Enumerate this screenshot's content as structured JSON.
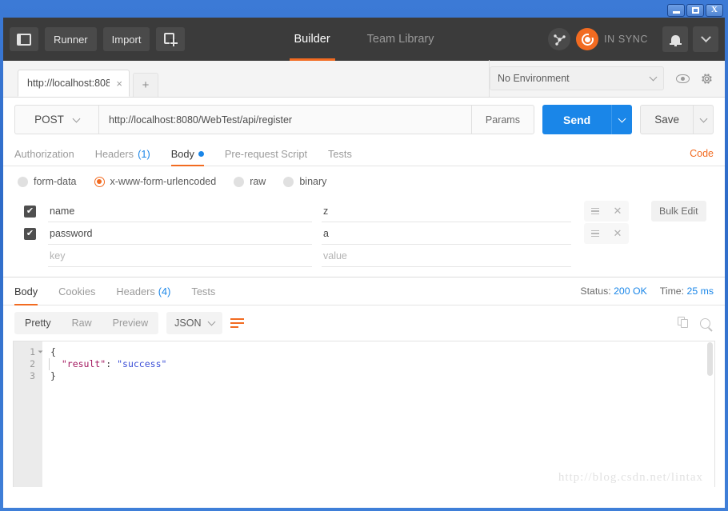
{
  "window": {
    "controls": {
      "minimize": "–",
      "maximize": "□",
      "close": "X"
    }
  },
  "header": {
    "sidebar_toggle": "sidebar-toggle",
    "runner_label": "Runner",
    "import_label": "Import",
    "new_label": "new-request",
    "nav_tabs": [
      {
        "label": "Builder",
        "active": true
      },
      {
        "label": "Team Library",
        "active": false
      }
    ],
    "sync_status": "IN SYNC",
    "accent_orange": "#f26b21",
    "accent_blue": "#1a86e8"
  },
  "tabstrip": {
    "request_tab_label": "http://localhost:808",
    "close_glyph": "×",
    "new_tab_glyph": "+",
    "environment_selected": "No Environment",
    "eye_icon": "eye-icon",
    "gear_icon": "gear-icon"
  },
  "request": {
    "method": "POST",
    "url": "http://localhost:8080/WebTest/api/register",
    "params_label": "Params",
    "send_label": "Send",
    "save_label": "Save",
    "tabs": [
      {
        "label": "Authorization",
        "count": "",
        "active": false,
        "dot": false
      },
      {
        "label": "Headers",
        "count": "(1)",
        "active": false,
        "dot": false
      },
      {
        "label": "Body",
        "count": "",
        "active": true,
        "dot": true
      },
      {
        "label": "Pre-request Script",
        "count": "",
        "active": false,
        "dot": false
      },
      {
        "label": "Tests",
        "count": "",
        "active": false,
        "dot": false
      }
    ],
    "code_link": "Code",
    "body_types": [
      {
        "label": "form-data",
        "selected": false
      },
      {
        "label": "x-www-form-urlencoded",
        "selected": true
      },
      {
        "label": "raw",
        "selected": false
      },
      {
        "label": "binary",
        "selected": false
      }
    ],
    "bulk_edit_label": "Bulk Edit",
    "key_placeholder": "key",
    "value_placeholder": "value",
    "params": [
      {
        "enabled": true,
        "key": "name",
        "value": "z"
      },
      {
        "enabled": true,
        "key": "password",
        "value": "a"
      }
    ]
  },
  "response": {
    "tabs": [
      {
        "label": "Body",
        "count": "",
        "active": true
      },
      {
        "label": "Cookies",
        "count": "",
        "active": false
      },
      {
        "label": "Headers",
        "count": "(4)",
        "active": false
      },
      {
        "label": "Tests",
        "count": "",
        "active": false
      }
    ],
    "status_label": "Status:",
    "status_value": "200 OK",
    "time_label": "Time:",
    "time_value": "25 ms",
    "view_modes": [
      {
        "label": "Pretty",
        "active": true
      },
      {
        "label": "Raw",
        "active": false
      },
      {
        "label": "Preview",
        "active": false
      }
    ],
    "format": "JSON",
    "wrap_icon": "word-wrap-icon",
    "copy_icon": "copy-icon",
    "search_icon": "search-icon",
    "body_lines": [
      {
        "num": "1",
        "foldable": true,
        "segments": [
          {
            "text": "{",
            "type": "punct"
          }
        ]
      },
      {
        "num": "2",
        "foldable": false,
        "segments": [
          {
            "text": "  \"result\"",
            "type": "key"
          },
          {
            "text": ": ",
            "type": "punct"
          },
          {
            "text": "\"success\"",
            "type": "str"
          }
        ]
      },
      {
        "num": "3",
        "foldable": false,
        "segments": [
          {
            "text": "}",
            "type": "punct"
          }
        ]
      }
    ],
    "watermark": "http://blog.csdn.net/lintax"
  }
}
